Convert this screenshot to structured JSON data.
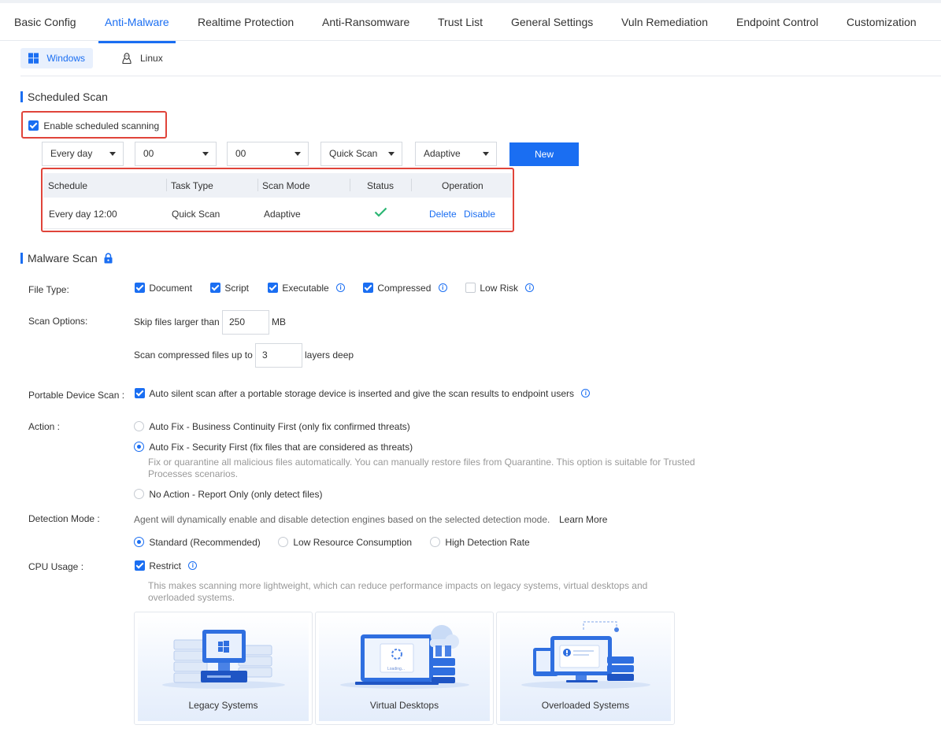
{
  "tabs": [
    {
      "label": "Basic Config"
    },
    {
      "label": "Anti-Malware"
    },
    {
      "label": "Realtime Protection"
    },
    {
      "label": "Anti-Ransomware"
    },
    {
      "label": "Trust List"
    },
    {
      "label": "General Settings"
    },
    {
      "label": "Vuln Remediation"
    },
    {
      "label": "Endpoint Control"
    },
    {
      "label": "Customization"
    }
  ],
  "os_tabs": [
    {
      "label": "Windows"
    },
    {
      "label": "Linux"
    }
  ],
  "scheduled_scan": {
    "title": "Scheduled Scan",
    "enable_label": "Enable scheduled scanning",
    "selects": {
      "frequency": "Every day",
      "hour": "00",
      "minute": "00",
      "task_type": "Quick Scan",
      "scan_mode": "Adaptive"
    },
    "new_button": "New",
    "table": {
      "headers": [
        "Schedule",
        "Task Type",
        "Scan Mode",
        "Status",
        "Operation"
      ],
      "rows": [
        {
          "schedule": "Every day 12:00",
          "task_type": "Quick Scan",
          "scan_mode": "Adaptive",
          "delete": "Delete",
          "disable": "Disable"
        }
      ]
    }
  },
  "malware_scan": {
    "title": "Malware Scan",
    "file_type": {
      "label": "File Type:",
      "options": [
        {
          "label": "Document"
        },
        {
          "label": "Script"
        },
        {
          "label": "Executable"
        },
        {
          "label": "Compressed"
        },
        {
          "label": "Low Risk"
        }
      ]
    },
    "scan_options": {
      "label": "Scan Options:",
      "skip_prefix": "Skip files larger than",
      "skip_value": "250",
      "skip_unit": "MB",
      "compressed_prefix": "Scan compressed files up to",
      "compressed_value": "3",
      "compressed_suffix": "layers deep"
    },
    "portable": {
      "label": "Portable Device Scan :",
      "text": "Auto silent scan after a portable storage device is inserted and give the scan results to endpoint users"
    },
    "action": {
      "label": "Action :",
      "option1": "Auto Fix - Business Continuity First (only fix confirmed threats)",
      "option2": "Auto Fix - Security First (fix files that are considered as threats)",
      "option2_hint": "Fix or quarantine all malicious files automatically. You can manually restore files from Quarantine. This option is suitable for Trusted Processes scenarios.",
      "option3": "No Action - Report Only (only detect files)"
    },
    "detection": {
      "label": "Detection Mode :",
      "desc": "Agent will dynamically enable and disable detection engines based on the selected detection mode.",
      "learn_more": "Learn More",
      "options": [
        {
          "label": "Standard (Recommended)"
        },
        {
          "label": "Low Resource Consumption"
        },
        {
          "label": "High Detection Rate"
        }
      ]
    },
    "cpu": {
      "label": "CPU Usage :",
      "restrict": "Restrict",
      "hint": "This makes scanning more lightweight, which can reduce performance impacts on legacy systems, virtual desktops and overloaded systems.",
      "cards": [
        {
          "label": "Legacy Systems"
        },
        {
          "label": "Virtual Desktops",
          "screen_text": "Loading..."
        },
        {
          "label": "Overloaded Systems"
        }
      ]
    }
  }
}
